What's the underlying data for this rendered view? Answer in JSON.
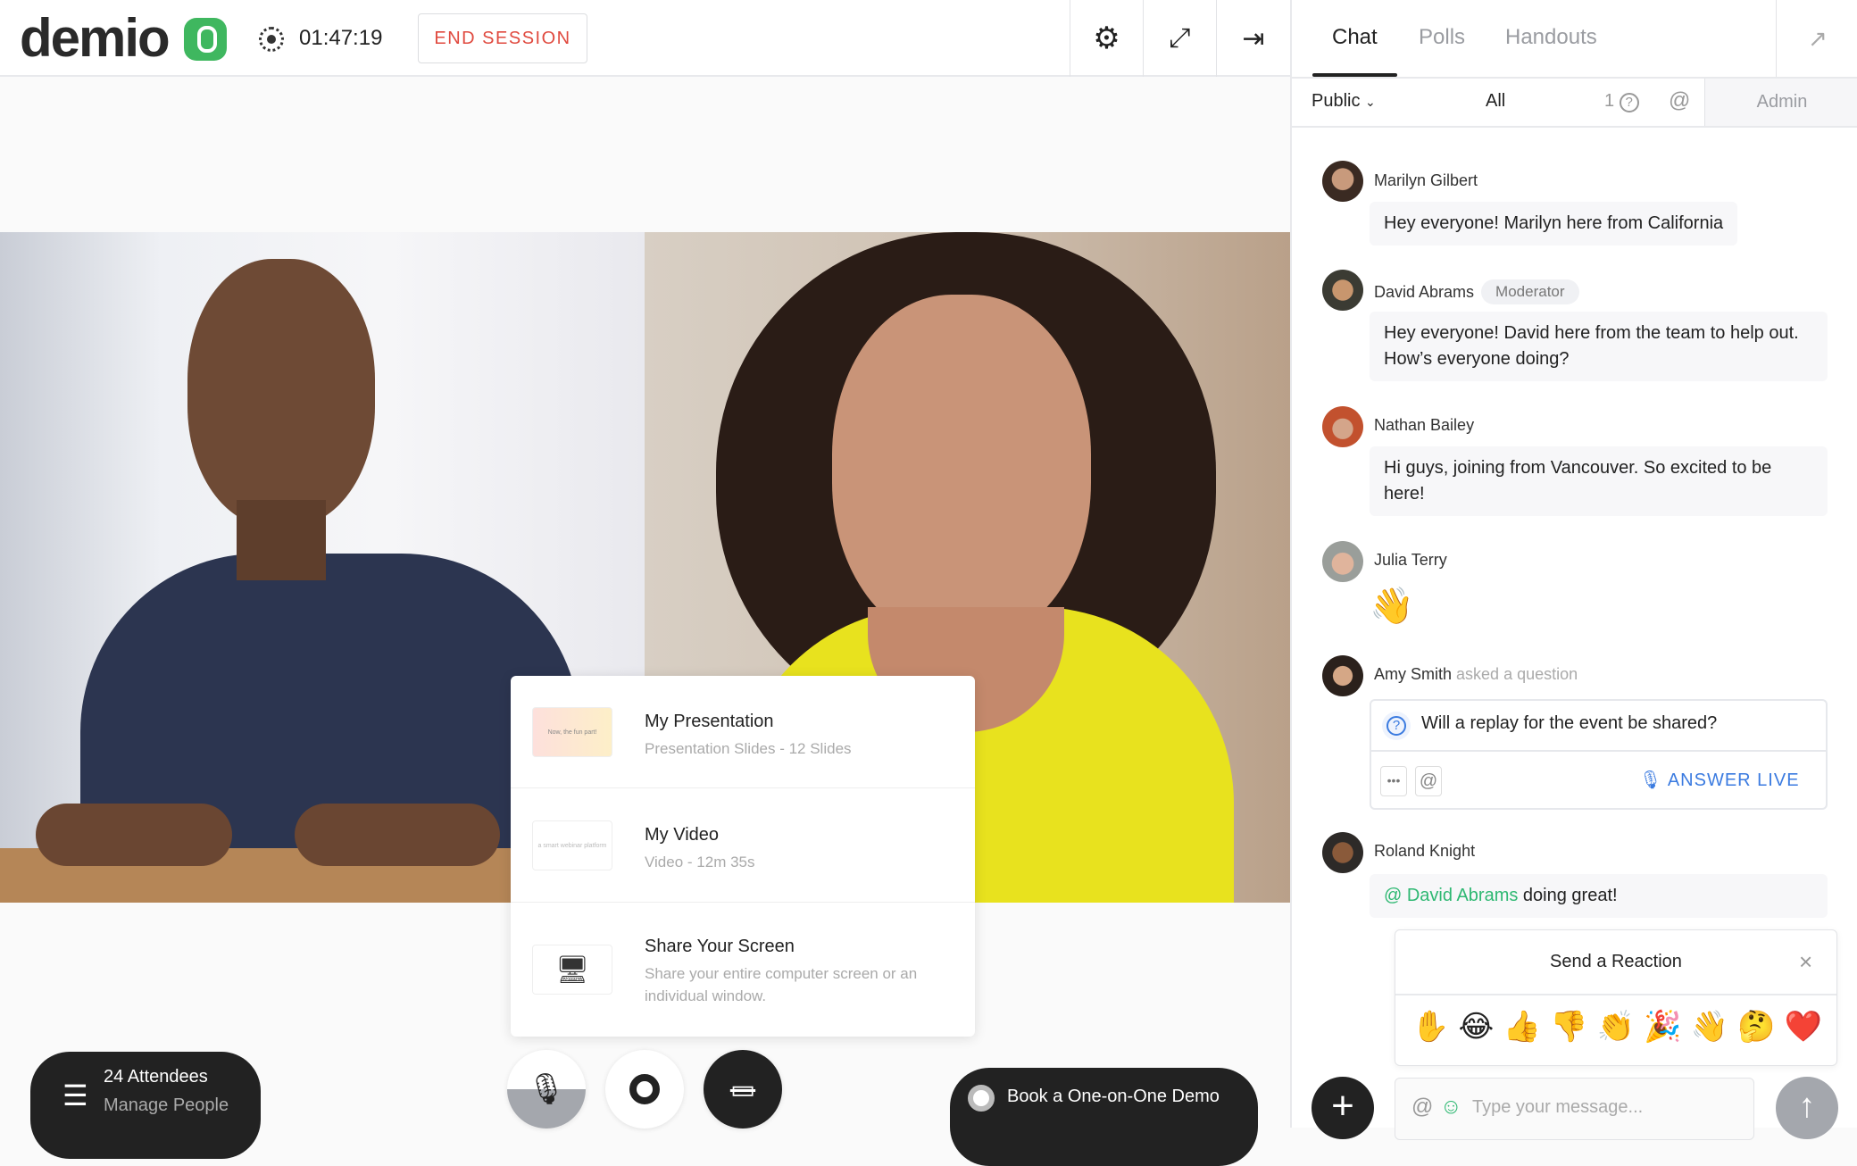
{
  "header": {
    "logo_text": "demio",
    "timer": "01:47:19",
    "end_session_label": "END SESSION",
    "icons": [
      "gear-icon",
      "expand-icon",
      "exit-icon"
    ]
  },
  "panel": {
    "tabs": [
      {
        "label": "Chat",
        "active": true
      },
      {
        "label": "Polls"
      },
      {
        "label": "Handouts"
      }
    ],
    "filter": {
      "visibility": "Public",
      "scope": "All",
      "question_count": "1",
      "admin_label": "Admin"
    },
    "messages": [
      {
        "name": "Marilyn Gilbert",
        "text": "Hey everyone! Marilyn here from California"
      },
      {
        "name": "David Abrams",
        "badge": "Moderator",
        "text": "Hey everyone! David here from the team to help out. How’s everyone doing?"
      },
      {
        "name": "Nathan Bailey",
        "text": "Hi guys, joining from Vancouver. So excited to be here!"
      },
      {
        "name": "Julia Terry",
        "emoji": "👋"
      },
      {
        "name": "Amy Smith",
        "note": "asked a question",
        "question": "Will a replay for the event be shared?",
        "answer_live_label": "ANSWER LIVE"
      },
      {
        "name": "Roland Knight",
        "mention": "@ David Abrams",
        "text": "doing great!"
      }
    ],
    "reaction": {
      "title": "Send a Reaction",
      "emojis": [
        "✋",
        "😂",
        "👍",
        "👎",
        "👏",
        "🎉",
        "👋",
        "🤔",
        "❤️"
      ]
    },
    "composer": {
      "placeholder": "Type your message..."
    }
  },
  "share_menu": {
    "items": [
      {
        "title": "My Presentation",
        "subtitle": "Presentation Slides - 12 Slides",
        "thumb_text": "Now, the fun part!"
      },
      {
        "title": "My Video",
        "subtitle": "Video - 12m 35s",
        "thumb_text": "a smart webinar platform"
      },
      {
        "title": "Share Your Screen",
        "subtitle": "Share your entire computer screen or an individual window."
      }
    ]
  },
  "bottom": {
    "attendees": "24 Attendees",
    "manage": "Manage People",
    "book_demo": "Book a One-on-One Demo"
  },
  "colors": {
    "accent_green": "#3fb75f",
    "end_session_red": "#e04a3f",
    "answer_blue": "#3b7be0",
    "mention_green": "#2eb872"
  }
}
